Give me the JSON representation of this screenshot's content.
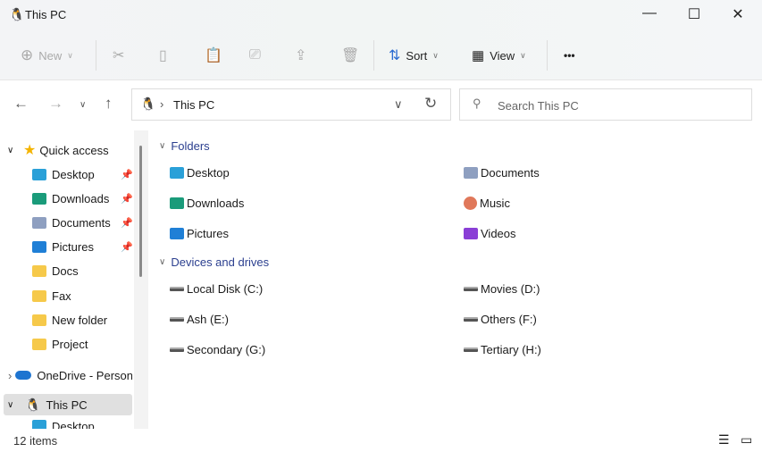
{
  "window": {
    "title": "This PC",
    "minimize": "—",
    "maximize": "☐",
    "close": "✕"
  },
  "toolbar": {
    "new_label": "New",
    "sort_label": "Sort",
    "view_label": "View",
    "more": "•••"
  },
  "address": {
    "location": "This PC",
    "separator": "›"
  },
  "search": {
    "placeholder": "Search This PC"
  },
  "sidebar": {
    "quick_access": "Quick access",
    "quick_items": [
      {
        "label": "Desktop",
        "icon": "desktop-icon",
        "color": "#2aa0d8",
        "pinned": true
      },
      {
        "label": "Downloads",
        "icon": "download-icon",
        "color": "#1a9b7a",
        "pinned": true
      },
      {
        "label": "Documents",
        "icon": "document-icon",
        "color": "#8e9fc0",
        "pinned": true
      },
      {
        "label": "Pictures",
        "icon": "pictures-icon",
        "color": "#1f7fd6",
        "pinned": true
      },
      {
        "label": "Docs",
        "icon": "folder-icon",
        "color": "#f6c94a",
        "pinned": false
      },
      {
        "label": "Fax",
        "icon": "folder-icon",
        "color": "#f6c94a",
        "pinned": false
      },
      {
        "label": "New folder",
        "icon": "folder-icon",
        "color": "#f6c94a",
        "pinned": false
      },
      {
        "label": "Project",
        "icon": "folder-icon",
        "color": "#f6c94a",
        "pinned": false
      }
    ],
    "onedrive": "OneDrive - Person",
    "this_pc": "This PC",
    "this_pc_child": "Desktop"
  },
  "main": {
    "folders_header": "Folders",
    "folders": [
      {
        "label": "Desktop",
        "icon": "desktop-icon",
        "color": "#2aa0d8"
      },
      {
        "label": "Documents",
        "icon": "document-icon",
        "color": "#8e9fc0"
      },
      {
        "label": "Downloads",
        "icon": "download-icon",
        "color": "#1a9b7a"
      },
      {
        "label": "Music",
        "icon": "music-icon",
        "color": "#e0785a"
      },
      {
        "label": "Pictures",
        "icon": "pictures-icon",
        "color": "#1f7fd6"
      },
      {
        "label": "Videos",
        "icon": "videos-icon",
        "color": "#8a3fd6"
      }
    ],
    "drives_header": "Devices and drives",
    "drives": [
      {
        "label": "Local Disk (C:)"
      },
      {
        "label": "Movies (D:)"
      },
      {
        "label": "Ash (E:)"
      },
      {
        "label": "Others (F:)"
      },
      {
        "label": "Secondary (G:)"
      },
      {
        "label": "Tertiary (H:)"
      }
    ]
  },
  "status": {
    "count": "12 items"
  }
}
